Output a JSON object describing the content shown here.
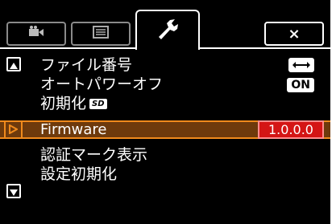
{
  "tabs": [
    {
      "id": "movie",
      "icon": "movie-camera-icon"
    },
    {
      "id": "menu",
      "icon": "menu-list-icon"
    },
    {
      "id": "setup",
      "icon": "wrench-icon",
      "active": true
    },
    {
      "id": "close",
      "icon": "close-icon",
      "label": "×"
    }
  ],
  "rows": [
    {
      "label": "ファイル番号",
      "value_icon": "continuous-numbering-icon"
    },
    {
      "label": "オートパワーオフ",
      "value": "ON"
    },
    {
      "label": "初期化",
      "badge": "SD"
    },
    {
      "label": "Firmware",
      "value": "1.0.0.0",
      "selected": true
    },
    {
      "label": "認証マーク表示"
    },
    {
      "label": "設定初期化"
    }
  ],
  "nav": {
    "up_icon": "scroll-up-icon",
    "down_icon": "scroll-down-icon"
  },
  "colors": {
    "background": "#000000",
    "highlight": "#6e3a0c",
    "highlight_border": "#f08a1c",
    "value_box": "#d41515"
  }
}
